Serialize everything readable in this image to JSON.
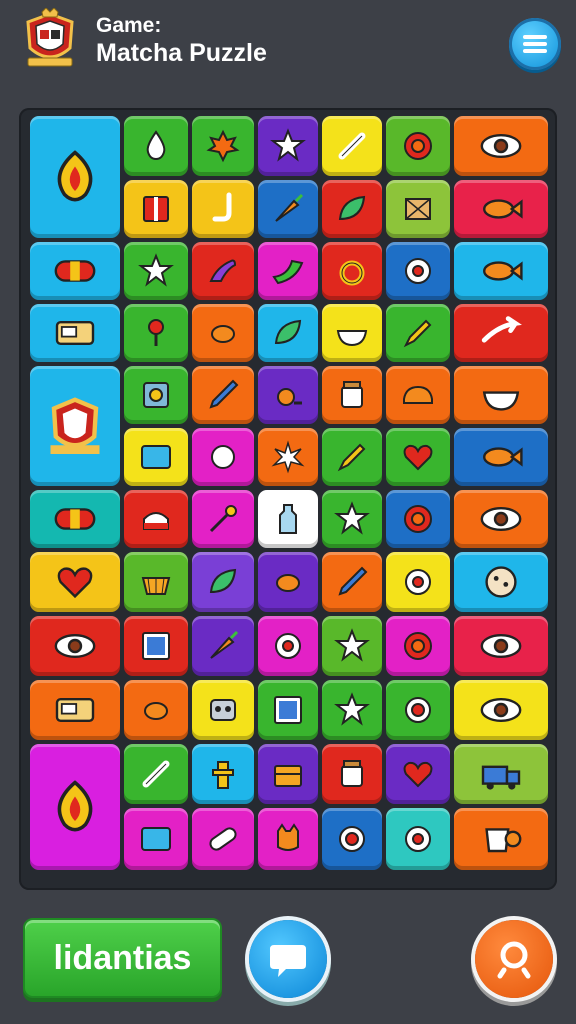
{
  "header": {
    "title_line1": "Game:",
    "title_line2": "Matcha Puzzle",
    "menu_icon": "hamburger-menu-icon"
  },
  "board": {
    "tiles": [
      {
        "color": "#1fb6ea",
        "icon": "flame-leaf-icon"
      },
      {
        "color": "#39b52e",
        "icon": "droplet-icon"
      },
      {
        "color": "#39b52e",
        "icon": "maple-leaf-icon"
      },
      {
        "color": "#6a2bc4",
        "icon": "star-icon"
      },
      {
        "color": "#f4e21a",
        "icon": "bone-icon"
      },
      {
        "color": "#59b82a",
        "icon": "gear-flower-icon"
      },
      {
        "color": "#f36a12",
        "icon": "eye-icon"
      },
      {
        "color": "#f4c418",
        "icon": "book-icon"
      },
      {
        "color": "#f4c418",
        "icon": "pipe-icon"
      },
      {
        "color": "#1e6fc6",
        "icon": "carrot-icon"
      },
      {
        "color": "#e0281e",
        "icon": "leaf-icon"
      },
      {
        "color": "#8dc43a",
        "icon": "crate-icon"
      },
      {
        "color": "#e8224a",
        "icon": "fish-icon"
      },
      {
        "color": "#1fb6ea",
        "icon": "capsule-icon"
      },
      {
        "color": "#39b52e",
        "icon": "star-icon"
      },
      {
        "color": "#e0281e",
        "icon": "lizard-icon"
      },
      {
        "color": "#e321c6",
        "icon": "bird-icon"
      },
      {
        "color": "#e0281e",
        "icon": "ring-icon"
      },
      {
        "color": "#1e6fc6",
        "icon": "gear-icon"
      },
      {
        "color": "#1fb6ea",
        "icon": "fish-icon"
      },
      {
        "color": "#1fb6ea",
        "icon": "radio-icon"
      },
      {
        "color": "#39b52e",
        "icon": "pin-icon"
      },
      {
        "color": "#f36a12",
        "icon": "bean-icon"
      },
      {
        "color": "#1fb6ea",
        "icon": "leaf-icon"
      },
      {
        "color": "#f4e21a",
        "icon": "bowl-icon"
      },
      {
        "color": "#39b52e",
        "icon": "pencil-icon"
      },
      {
        "color": "#e0281e",
        "icon": "arrow-icon"
      },
      {
        "color": "#1fb6ea",
        "icon": "crest-icon"
      },
      {
        "color": "#39b52e",
        "icon": "safe-icon"
      },
      {
        "color": "#f36a12",
        "icon": "pen-icon"
      },
      {
        "color": "#6a2bc4",
        "icon": "snail-icon"
      },
      {
        "color": "#f36a12",
        "icon": "jar-icon"
      },
      {
        "color": "#f36a12",
        "icon": "bread-icon"
      },
      {
        "color": "#f36a12",
        "icon": "bowl-icon"
      },
      {
        "color": "#f4e21a",
        "icon": "screen-icon"
      },
      {
        "color": "#e321c6",
        "icon": "ball-icon"
      },
      {
        "color": "#f36a12",
        "icon": "burst-icon"
      },
      {
        "color": "#39b52e",
        "icon": "pencil-icon"
      },
      {
        "color": "#39b52e",
        "icon": "heart-icon"
      },
      {
        "color": "#1e6fc6",
        "icon": "fish-icon"
      },
      {
        "color": "#14b8b0",
        "icon": "capsule-icon"
      },
      {
        "color": "#e0281e",
        "icon": "cake-icon"
      },
      {
        "color": "#e321c6",
        "icon": "wand-icon"
      },
      {
        "color": "#ffffff",
        "icon": "bottle-icon"
      },
      {
        "color": "#39b52e",
        "icon": "star-icon"
      },
      {
        "color": "#1e6fc6",
        "icon": "gear-flower-icon"
      },
      {
        "color": "#f36a12",
        "icon": "eye-icon"
      },
      {
        "color": "#f4c418",
        "icon": "heart-icon"
      },
      {
        "color": "#59b82a",
        "icon": "basket-icon"
      },
      {
        "color": "#7a3fd6",
        "icon": "leaf-icon"
      },
      {
        "color": "#6a2bc4",
        "icon": "bean-icon"
      },
      {
        "color": "#f36a12",
        "icon": "pen-icon"
      },
      {
        "color": "#f4e21a",
        "icon": "gear-icon"
      },
      {
        "color": "#1fb6ea",
        "icon": "cookie-icon"
      },
      {
        "color": "#e0281e",
        "icon": "eye-icon"
      },
      {
        "color": "#e0281e",
        "icon": "frame-icon"
      },
      {
        "color": "#6a2bc4",
        "icon": "carrot-icon"
      },
      {
        "color": "#e321c6",
        "icon": "gear-icon"
      },
      {
        "color": "#59b82a",
        "icon": "star-icon"
      },
      {
        "color": "#e321c6",
        "icon": "gear-flower-icon"
      },
      {
        "color": "#e8224a",
        "icon": "eye-icon"
      },
      {
        "color": "#f36a12",
        "icon": "radio-icon"
      },
      {
        "color": "#f36a12",
        "icon": "bean-icon"
      },
      {
        "color": "#f4e21a",
        "icon": "robot-icon"
      },
      {
        "color": "#39b52e",
        "icon": "frame-icon"
      },
      {
        "color": "#39b52e",
        "icon": "star-icon"
      },
      {
        "color": "#39b52e",
        "icon": "target-icon"
      },
      {
        "color": "#f4e21a",
        "icon": "eye-icon"
      },
      {
        "color": "#d91fe0",
        "icon": "flame-leaf-icon"
      },
      {
        "color": "#39b52e",
        "icon": "bone-icon"
      },
      {
        "color": "#1fb6ea",
        "icon": "totem-icon"
      },
      {
        "color": "#6a2bc4",
        "icon": "chest-icon"
      },
      {
        "color": "#e0281e",
        "icon": "jar-icon"
      },
      {
        "color": "#6a2bc4",
        "icon": "heart-icon"
      },
      {
        "color": "#8dc43a",
        "icon": "truck-icon"
      },
      {
        "color": "#e321c6",
        "icon": "screen-icon"
      },
      {
        "color": "#e321c6",
        "icon": "bandage-icon"
      },
      {
        "color": "#e321c6",
        "icon": "cat-icon"
      },
      {
        "color": "#1e6fc6",
        "icon": "target-icon"
      },
      {
        "color": "#2ec8c0",
        "icon": "gear-icon"
      },
      {
        "color": "#f36a12",
        "icon": "cup-icon"
      }
    ]
  },
  "footer": {
    "primary_button_label": "lidantias",
    "blue_button_icon": "speech-bubble-icon",
    "orange_button_icon": "search-icon"
  }
}
